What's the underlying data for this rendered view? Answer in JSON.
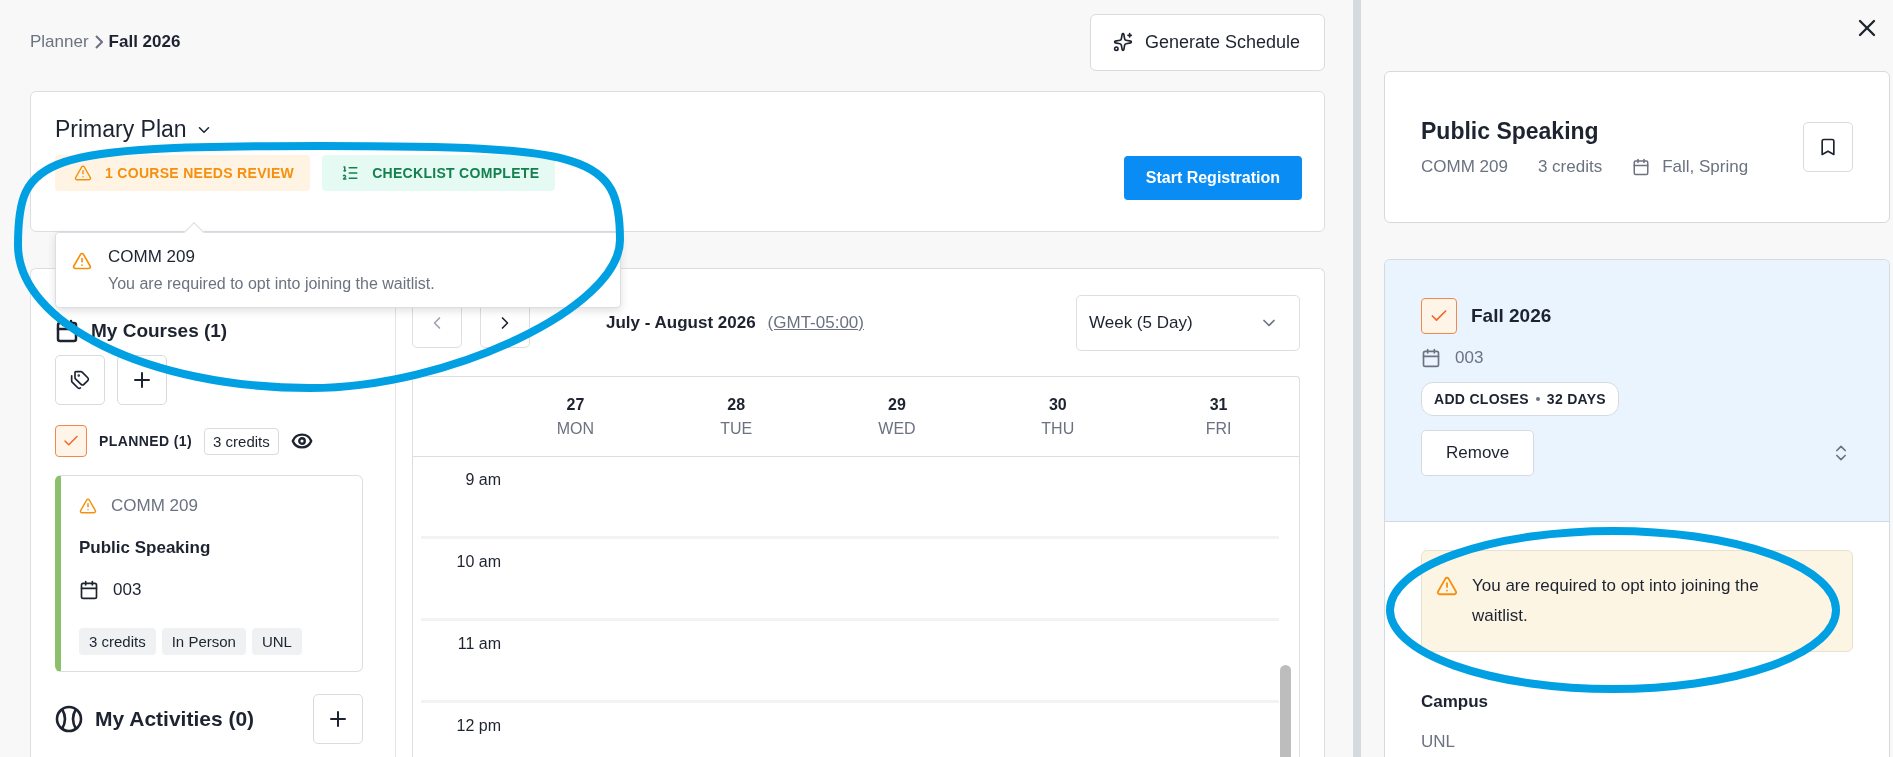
{
  "breadcrumb": {
    "items": [
      "Planner",
      "Fall 2026"
    ]
  },
  "generate_button": "Generate Schedule",
  "plan": {
    "title": "Primary Plan",
    "badges": [
      {
        "kind": "warning",
        "label": "1 COURSE NEEDS REVIEW"
      },
      {
        "kind": "success",
        "label": "CHECKLIST COMPLETE"
      }
    ],
    "register_button": "Start Registration"
  },
  "review_popover": {
    "course": "COMM 209",
    "message": "You are required to opt into joining the waitlist."
  },
  "my_courses": {
    "title": "My Courses (1)",
    "planned": {
      "label": "PLANNED (1)",
      "checked": true,
      "credits": "3 credits"
    },
    "courses": [
      {
        "code": "COMM 209",
        "warning": true,
        "title": "Public Speaking",
        "section": "003",
        "tags": [
          "3 credits",
          "In Person",
          "UNL"
        ]
      }
    ]
  },
  "my_activities": {
    "title": "My Activities (0)"
  },
  "calendar": {
    "range": "July - August 2026",
    "timezone": "(GMT-05:00)",
    "view": "Week (5 Day)",
    "days": [
      {
        "date": "27",
        "weekday": "MON"
      },
      {
        "date": "28",
        "weekday": "TUE"
      },
      {
        "date": "29",
        "weekday": "WED"
      },
      {
        "date": "30",
        "weekday": "THU"
      },
      {
        "date": "31",
        "weekday": "FRI"
      }
    ],
    "hours": [
      "9 am",
      "10 am",
      "11 am",
      "12 pm"
    ]
  },
  "detail": {
    "title": "Public Speaking",
    "code": "COMM 209",
    "credits": "3 credits",
    "terms": "Fall, Spring",
    "term_section": {
      "term": "Fall 2026",
      "checked": true,
      "section": "003",
      "deadline": "ADD CLOSES",
      "days_left": "32 DAYS",
      "remove": "Remove"
    },
    "alert": "You are required to opt into joining the waitlist.",
    "fields": [
      {
        "label": "Campus",
        "value": "UNL"
      }
    ]
  }
}
